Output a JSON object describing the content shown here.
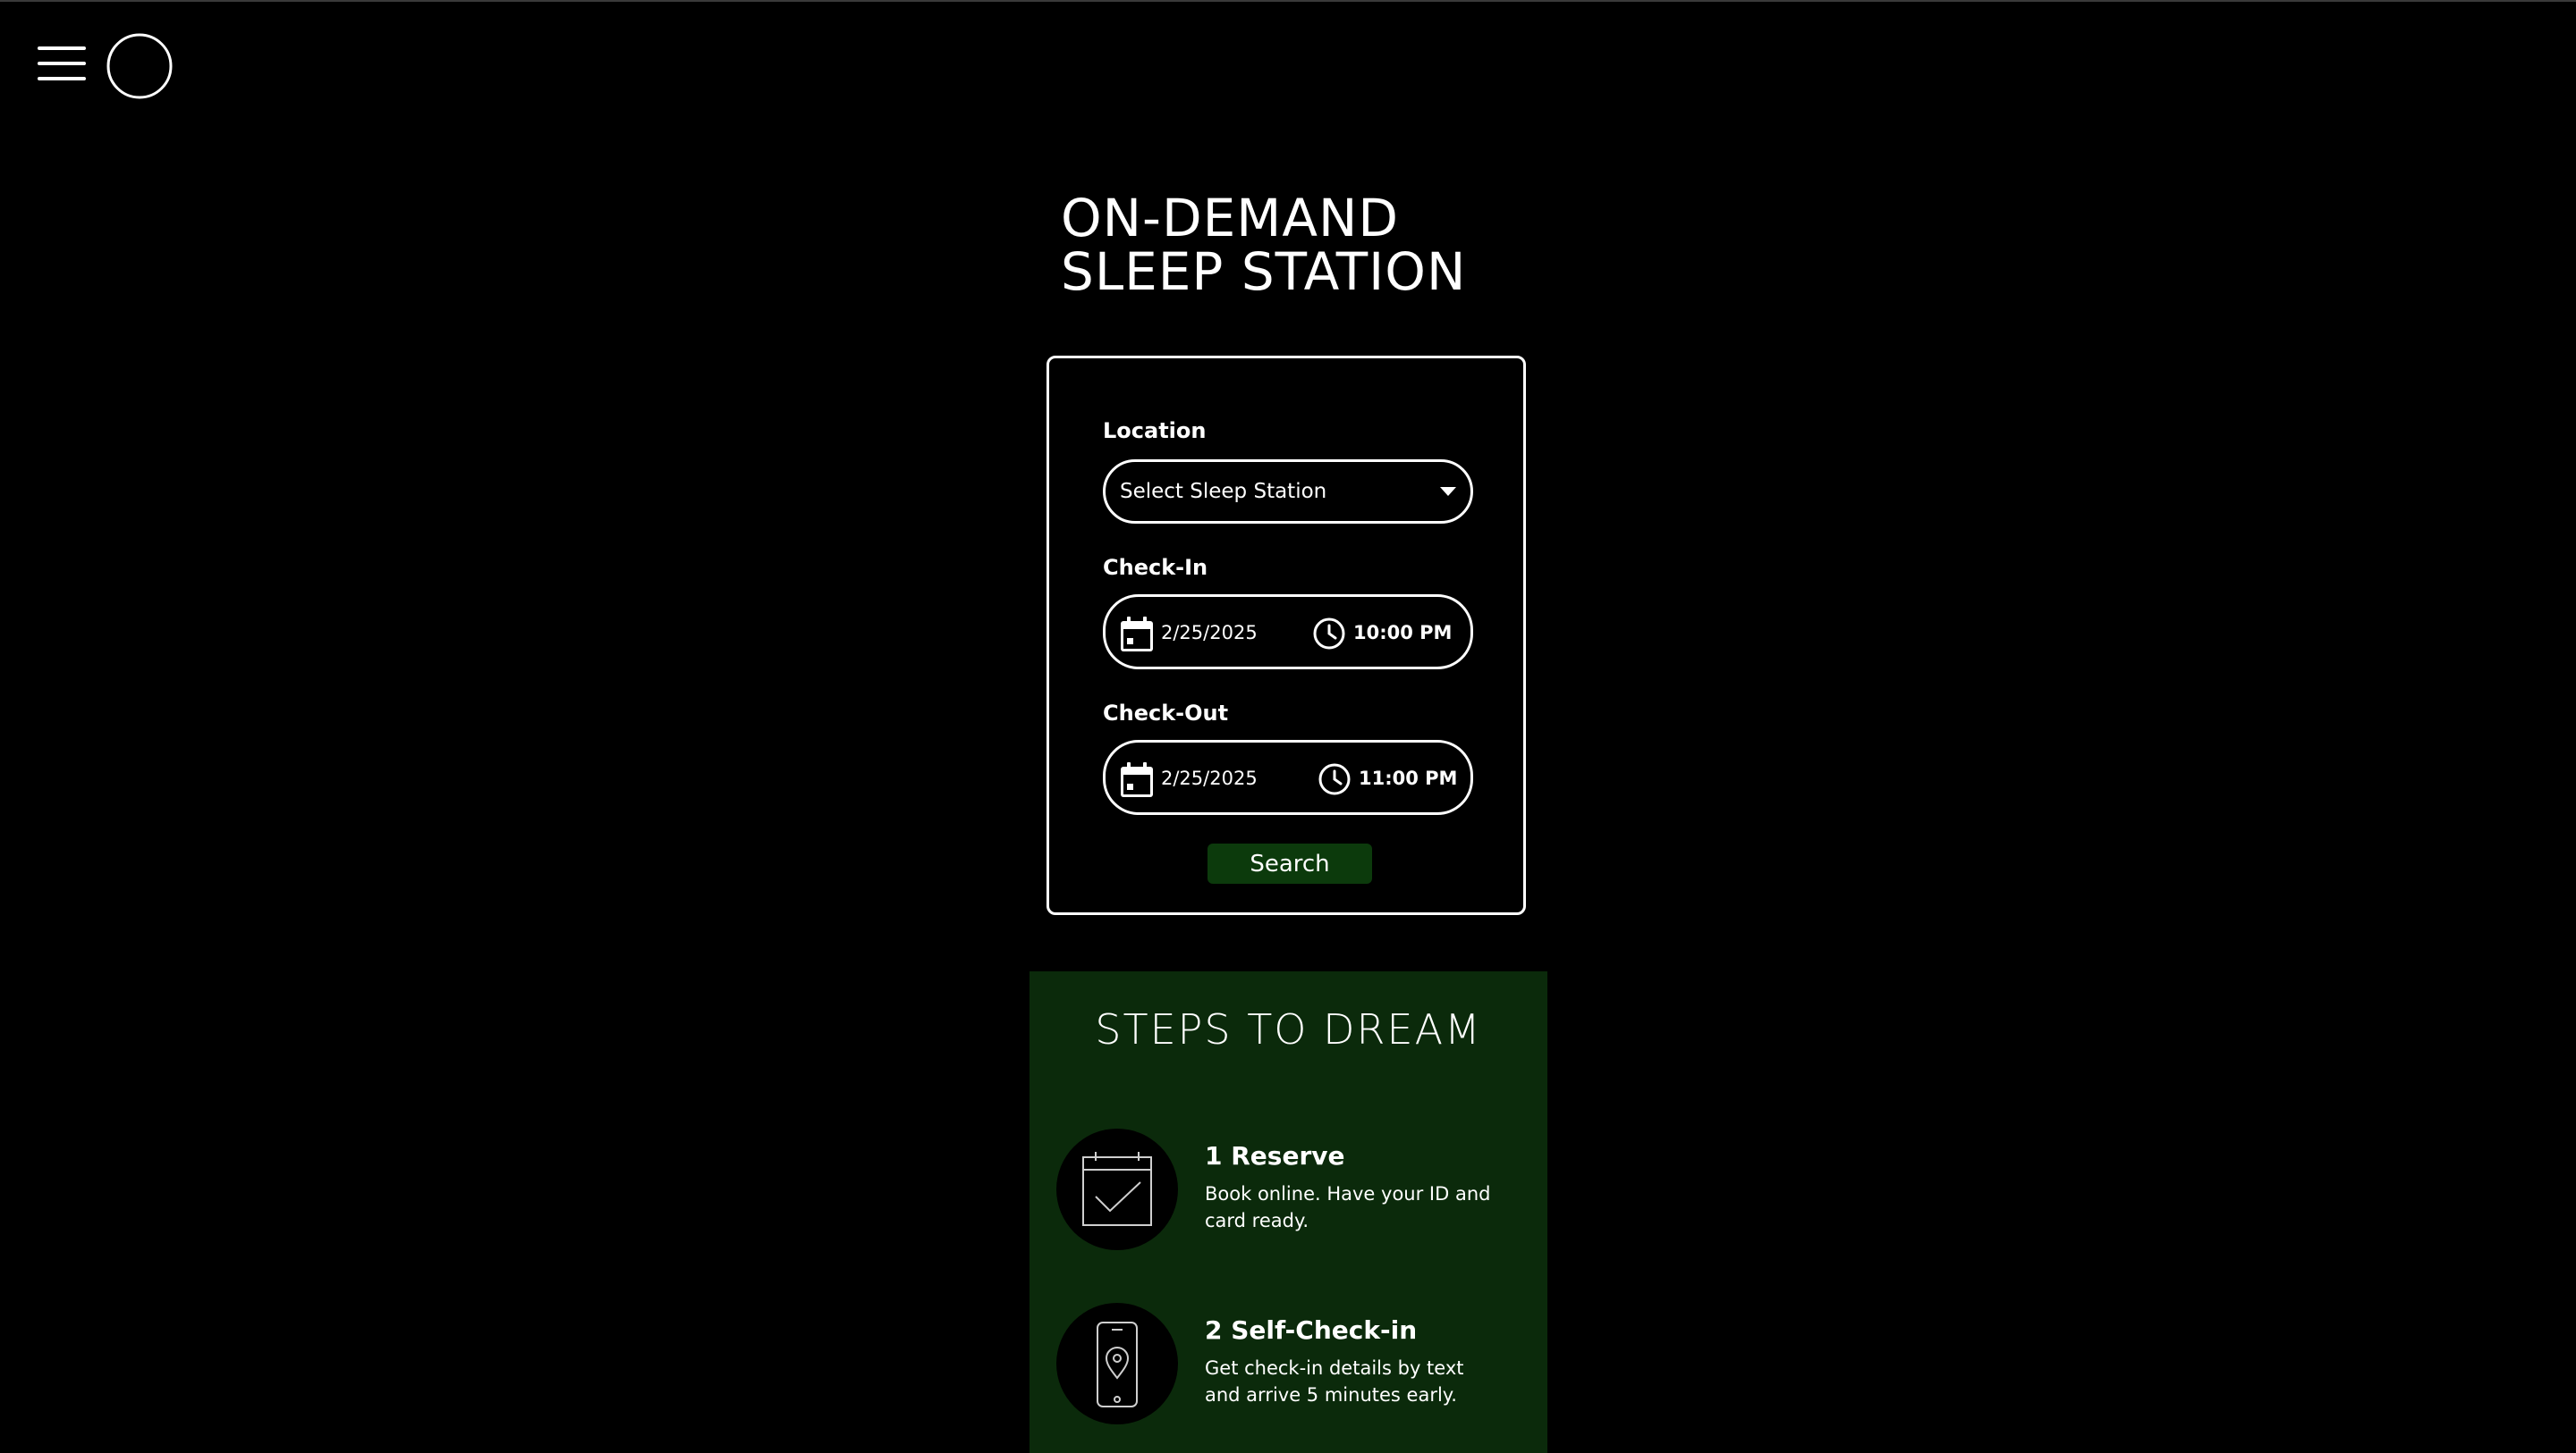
{
  "page_title": {
    "line1": "ON-DEMAND",
    "line2": "SLEEP STATION"
  },
  "header": {
    "menu_icon": "hamburger-menu-icon",
    "logo_icon": "crescent-moon-logo"
  },
  "booking": {
    "location": {
      "label": "Location",
      "selected": "Select Sleep Station"
    },
    "check_in": {
      "label": "Check-In",
      "date": "2/25/2025",
      "time": "10:00 PM"
    },
    "check_out": {
      "label": "Check-Out",
      "date": "2/25/2025",
      "time": "11:00 PM"
    },
    "search_label": "Search"
  },
  "steps": {
    "title": "STEPS TO DREAM",
    "items": [
      {
        "heading": "1 Reserve",
        "description": "Book online. Have your ID and card ready.",
        "icon": "calendar-check-icon"
      },
      {
        "heading": "2 Self-Check-in",
        "description": "Get check-in details by text and arrive 5 minutes early.",
        "icon": "phone-location-icon"
      }
    ]
  },
  "colors": {
    "background": "#000000",
    "accent_green": "#0c3a0c",
    "panel_green": "#0b2a0b",
    "text": "#ffffff"
  }
}
